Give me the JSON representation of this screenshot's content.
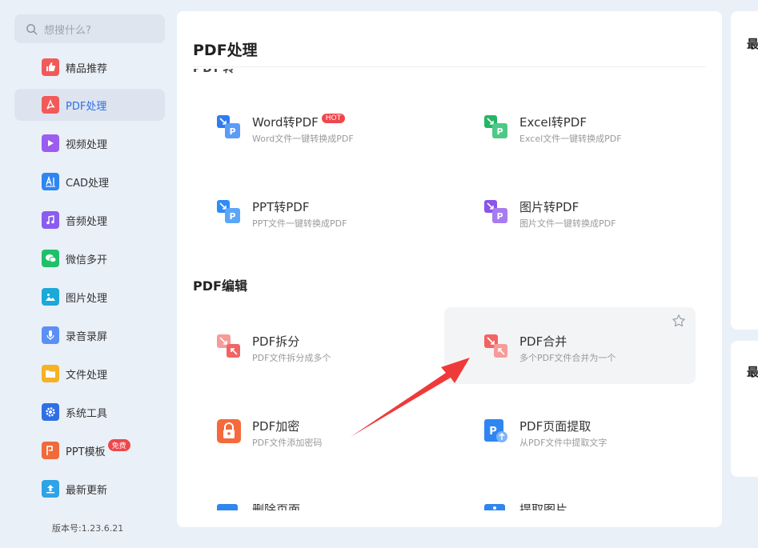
{
  "search": {
    "placeholder": "想搜什么?"
  },
  "sidebar": {
    "items": [
      {
        "label": "精品推荐",
        "icon": "thumbs-up-icon",
        "color": "#f25a5a"
      },
      {
        "label": "PDF处理",
        "icon": "pdf-icon",
        "color": "#f25a5a",
        "active": true
      },
      {
        "label": "视频处理",
        "icon": "play-icon",
        "color": "#9b5cf0"
      },
      {
        "label": "CAD处理",
        "icon": "cad-icon",
        "color": "#2f86f0"
      },
      {
        "label": "音频处理",
        "icon": "music-icon",
        "color": "#8a5cf0"
      },
      {
        "label": "微信多开",
        "icon": "wechat-icon",
        "color": "#1fc06a"
      },
      {
        "label": "图片处理",
        "icon": "image-icon",
        "color": "#1aa9d8"
      },
      {
        "label": "录音录屏",
        "icon": "microphone-icon",
        "color": "#5b8ff5"
      },
      {
        "label": "文件处理",
        "icon": "folder-icon",
        "color": "#f5b224"
      },
      {
        "label": "系统工具",
        "icon": "gear-icon",
        "color": "#2f6fe4"
      },
      {
        "label": "PPT模板",
        "icon": "ppt-icon",
        "color": "#f06a3a",
        "badge": "免费"
      },
      {
        "label": "最新更新",
        "icon": "upload-icon",
        "color": "#2fa3e8"
      }
    ],
    "version": "版本号:1.23.6.21"
  },
  "main": {
    "title": "PDF处理",
    "cut_heading": "PDF转",
    "sections": {
      "convert": {
        "tools": [
          {
            "name": "Word转PDF",
            "desc": "Word文件一键转换成PDF",
            "hot": "HOT",
            "color": "#2f7cf0"
          },
          {
            "name": "Excel转PDF",
            "desc": "Excel文件一键转换成PDF",
            "color": "#26b566"
          },
          {
            "name": "PPT转PDF",
            "desc": "PPT文件一键转换成PDF",
            "color": "#2f8cf5"
          },
          {
            "name": "图片转PDF",
            "desc": "图片文件一键转换成PDF",
            "color": "#8a55e8"
          }
        ]
      },
      "edit": {
        "title": "PDF编辑",
        "tools": [
          {
            "name": "PDF拆分",
            "desc": "PDF文件拆分成多个",
            "color": "#f26464"
          },
          {
            "name": "PDF合并",
            "desc": "多个PDF文件合并为一个",
            "color": "#f26464"
          },
          {
            "name": "PDF加密",
            "desc": "PDF文件添加密码",
            "color": "#f46a3c"
          },
          {
            "name": "PDF页面提取",
            "desc": "从PDF文件中提取文字",
            "color": "#2f86f0"
          },
          {
            "name": "删除页面",
            "color": "#2f86f0"
          },
          {
            "name": "提取图片",
            "color": "#2f86f0"
          }
        ]
      }
    }
  },
  "right": {
    "label1": "最",
    "label2": "最"
  }
}
